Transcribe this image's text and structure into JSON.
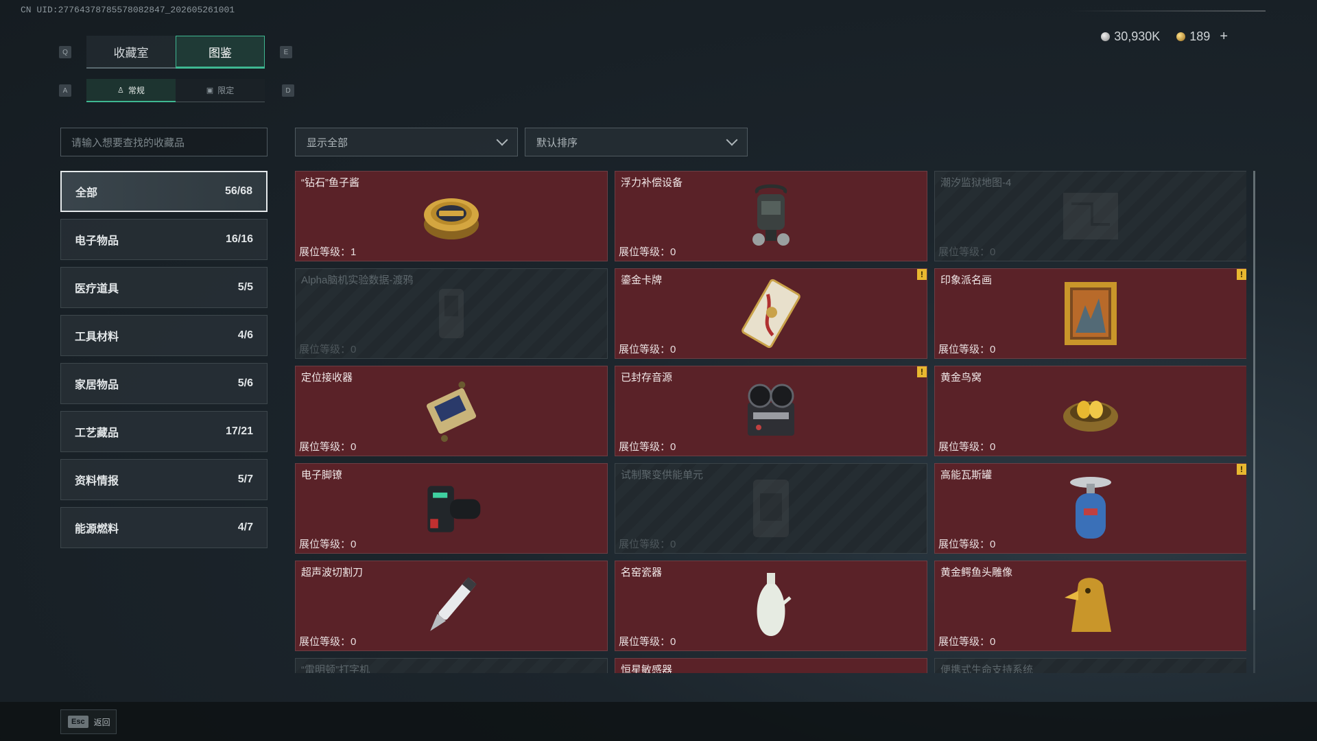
{
  "header": {
    "uid": "CN UID:27764378785578082847_202605261001",
    "currency": [
      {
        "icon": "silver-coin-icon",
        "value": "30,930K"
      },
      {
        "icon": "gold-coin-icon",
        "value": "189"
      }
    ],
    "add_label": "+"
  },
  "keys": {
    "q": "Q",
    "e": "E",
    "a": "A",
    "d": "D"
  },
  "tabs": [
    {
      "label": "收藏室",
      "active": false
    },
    {
      "label": "图鉴",
      "active": true
    }
  ],
  "subtabs": [
    {
      "label": "常规",
      "icon": "figure-icon",
      "active": true
    },
    {
      "label": "限定",
      "icon": "frame-icon",
      "active": false
    }
  ],
  "search": {
    "placeholder": "请输入想要查找的收藏品"
  },
  "filters": {
    "show": "显示全部",
    "sort": "默认排序"
  },
  "categories": [
    {
      "label": "全部",
      "count": "56/68",
      "active": true
    },
    {
      "label": "电子物品",
      "count": "16/16",
      "active": false
    },
    {
      "label": "医疗道具",
      "count": "5/5",
      "active": false
    },
    {
      "label": "工具材料",
      "count": "4/6",
      "active": false
    },
    {
      "label": "家居物品",
      "count": "5/6",
      "active": false
    },
    {
      "label": "工艺藏品",
      "count": "17/21",
      "active": false
    },
    {
      "label": "资料情报",
      "count": "5/7",
      "active": false
    },
    {
      "label": "能源燃料",
      "count": "4/7",
      "active": false
    }
  ],
  "items": [
    {
      "name": "“钻石”鱼子酱",
      "level": "展位等级：1",
      "icon": "caviar-tin-icon",
      "locked": false,
      "warn": false
    },
    {
      "name": "浮力补偿设备",
      "level": "展位等级：0",
      "icon": "buoyancy-device-icon",
      "locked": false,
      "warn": false
    },
    {
      "name": "潮汐监狱地图-4",
      "level": "展位等级：0",
      "icon": "map-icon",
      "locked": true,
      "warn": false
    },
    {
      "name": "Alpha脑机实验数据-渡鸦",
      "level": "展位等级：0",
      "icon": "data-drive-icon",
      "locked": true,
      "warn": false
    },
    {
      "name": "鎏金卡牌",
      "level": "展位等级：0",
      "icon": "gilded-card-icon",
      "locked": false,
      "warn": true
    },
    {
      "name": "印象派名画",
      "level": "展位等级：0",
      "icon": "painting-icon",
      "locked": false,
      "warn": true
    },
    {
      "name": "定位接收器",
      "level": "展位等级：0",
      "icon": "receiver-icon",
      "locked": false,
      "warn": false
    },
    {
      "name": "已封存音源",
      "level": "展位等级：0",
      "icon": "tape-recorder-icon",
      "locked": false,
      "warn": true
    },
    {
      "name": "黄金鸟窝",
      "level": "展位等级：0",
      "icon": "golden-nest-icon",
      "locked": false,
      "warn": false
    },
    {
      "name": "电子脚镣",
      "level": "展位等级：0",
      "icon": "ankle-monitor-icon",
      "locked": false,
      "warn": false
    },
    {
      "name": "试制聚变供能单元",
      "level": "展位等级：0",
      "icon": "fusion-unit-icon",
      "locked": true,
      "warn": false
    },
    {
      "name": "高能瓦斯罐",
      "level": "展位等级：0",
      "icon": "gas-canister-icon",
      "locked": false,
      "warn": true
    },
    {
      "name": "超声波切割刀",
      "level": "展位等级：0",
      "icon": "cutting-knife-icon",
      "locked": false,
      "warn": false
    },
    {
      "name": "名窑瓷器",
      "level": "展位等级：0",
      "icon": "porcelain-vase-icon",
      "locked": false,
      "warn": false
    },
    {
      "name": "黄金鳄鱼头雕像",
      "level": "展位等级：0",
      "icon": "gold-croc-statue-icon",
      "locked": false,
      "warn": false
    },
    {
      "name": "“雷明顿”打字机",
      "level": "",
      "icon": "typewriter-icon",
      "locked": true,
      "warn": false
    },
    {
      "name": "恒星敏感器",
      "level": "",
      "icon": "star-sensor-icon",
      "locked": false,
      "warn": false
    },
    {
      "name": "便携式生命支持系统",
      "level": "",
      "icon": "life-support-icon",
      "locked": true,
      "warn": false
    }
  ],
  "warn_label": "!",
  "footer": {
    "esc_key": "Esc",
    "back_label": "返回"
  }
}
